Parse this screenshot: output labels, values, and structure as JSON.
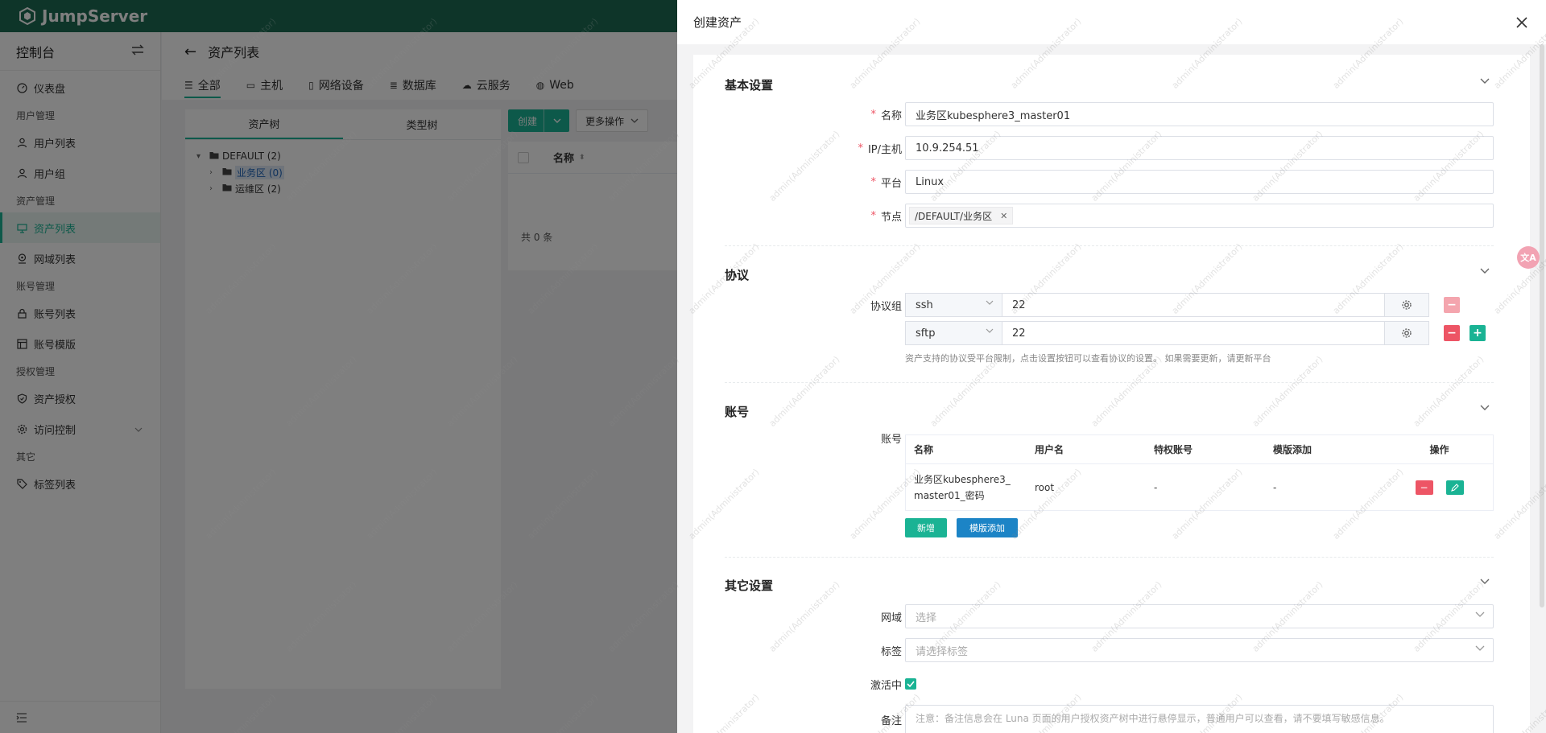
{
  "app": {
    "brand": "JumpServer"
  },
  "sidebar": {
    "title": "控制台",
    "items": [
      {
        "type": "item",
        "label": "仪表盘",
        "icon": "dashboard-icon"
      },
      {
        "type": "group",
        "label": "用户管理"
      },
      {
        "type": "item",
        "label": "用户列表",
        "icon": "user-icon"
      },
      {
        "type": "item",
        "label": "用户组",
        "icon": "users-icon"
      },
      {
        "type": "group",
        "label": "资产管理"
      },
      {
        "type": "item",
        "label": "资产列表",
        "icon": "desktop-icon",
        "active": true
      },
      {
        "type": "item",
        "label": "网域列表",
        "icon": "location-icon"
      },
      {
        "type": "group",
        "label": "账号管理"
      },
      {
        "type": "item",
        "label": "账号列表",
        "icon": "lock-icon"
      },
      {
        "type": "item",
        "label": "账号模版",
        "icon": "template-icon"
      },
      {
        "type": "group",
        "label": "授权管理"
      },
      {
        "type": "item",
        "label": "资产授权",
        "icon": "shield-icon"
      },
      {
        "type": "item",
        "label": "访问控制",
        "icon": "gear-icon",
        "expandable": true
      },
      {
        "type": "group",
        "label": "其它"
      },
      {
        "type": "item",
        "label": "标签列表",
        "icon": "tag-icon"
      }
    ]
  },
  "main": {
    "title": "资产列表",
    "tabs": [
      {
        "label": "全部",
        "icon": "list-icon",
        "active": true
      },
      {
        "label": "主机",
        "icon": "monitor-icon"
      },
      {
        "label": "网络设备",
        "icon": "device-icon"
      },
      {
        "label": "数据库",
        "icon": "database-icon"
      },
      {
        "label": "云服务",
        "icon": "cloud-icon"
      },
      {
        "label": "Web",
        "icon": "globe-icon"
      }
    ],
    "tree_tabs": [
      "资产树",
      "类型树"
    ],
    "tree": [
      {
        "label": "DEFAULT (2)",
        "level": 0,
        "expanded": true
      },
      {
        "label": "业务区 (0)",
        "level": 1,
        "selected": true
      },
      {
        "label": "运维区 (2)",
        "level": 1
      }
    ],
    "create_label": "创建",
    "more_label": "更多操作",
    "table_header_name": "名称",
    "total": "共 0 条"
  },
  "drawer": {
    "title": "创建资产",
    "basic": {
      "title": "基本设置",
      "name_label": "名称",
      "name_value": "业务区kubesphere3_master01",
      "ip_label": "IP/主机",
      "ip_value": "10.9.254.51",
      "platform_label": "平台",
      "platform_value": "Linux",
      "node_label": "节点",
      "node_value": "/DEFAULT/业务区"
    },
    "protocol": {
      "title": "协议",
      "group_label": "协议组",
      "rows": [
        {
          "name": "ssh",
          "port": "22"
        },
        {
          "name": "sftp",
          "port": "22"
        }
      ],
      "hint": "资产支持的协议受平台限制，点击设置按钮可以查看协议的设置。 如果需要更新，请更新平台"
    },
    "account": {
      "title": "账号",
      "label": "账号",
      "headers": [
        "名称",
        "用户名",
        "特权账号",
        "模版添加",
        "操作"
      ],
      "rows": [
        {
          "name_line1": "业务区kubesphere3_",
          "name_line2": "master01_密码",
          "username": "root",
          "privileged": "-",
          "template": "-"
        }
      ],
      "add_label": "新增",
      "template_label": "模版添加"
    },
    "other": {
      "title": "其它设置",
      "domain_label": "网域",
      "domain_placeholder": "选择",
      "labels_label": "标签",
      "labels_placeholder": "请选择标签",
      "active_label": "激活中",
      "active": true,
      "comment_label": "备注",
      "comment_placeholder": "注意：备注信息会在 Luna 页面的用户授权资产树中进行悬停显示，普通用户可以查看，请不要填写敏感信息。"
    }
  },
  "watermark": "admin(Administrator)",
  "translate_fab": "文A",
  "colors": {
    "brand": "#1c6b52",
    "primary": "#1ab394",
    "danger": "#ed5565",
    "info": "#1c84c6"
  }
}
